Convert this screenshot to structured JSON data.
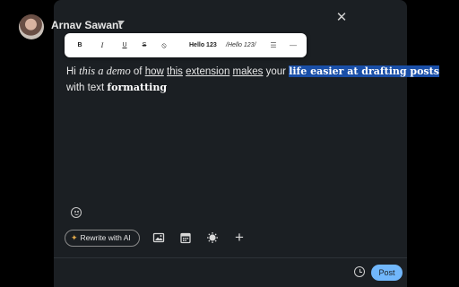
{
  "header": {
    "author_name": "Arnav Sawant",
    "close_glyph": "✕",
    "icons": [
      "avatar",
      "chevron-down-icon",
      "close-icon"
    ]
  },
  "format_toolbar": {
    "bold": "B",
    "italic": "I",
    "underline": "U",
    "strikethrough": "S",
    "clear": "⦸",
    "sample_bold": "Hello 123",
    "sample_italic": "/Hello 123/",
    "list": "☰",
    "divider": "—"
  },
  "editor": {
    "segments": {
      "s1": "Hi ",
      "s2": "this a demo",
      "s3": " of ",
      "s4": "how",
      "s5": " ",
      "s6": "this",
      "s7": " ",
      "s8": "extension",
      "s9": " ",
      "s10": "makes",
      "s11": " your ",
      "s12": "life easier at drafting posts",
      "s13": "with text ",
      "s14": "formatting"
    },
    "selection_color": "#1a4fa8"
  },
  "actions": {
    "ai_button": "Rewrite with AI",
    "ai_spark": "✦",
    "more_glyph": "+",
    "post_button": "Post",
    "post_color": "#71b7fb",
    "icons": [
      "emoji-icon",
      "media-icon",
      "event-icon",
      "celebrate-icon",
      "plus-icon",
      "clock-icon"
    ]
  }
}
